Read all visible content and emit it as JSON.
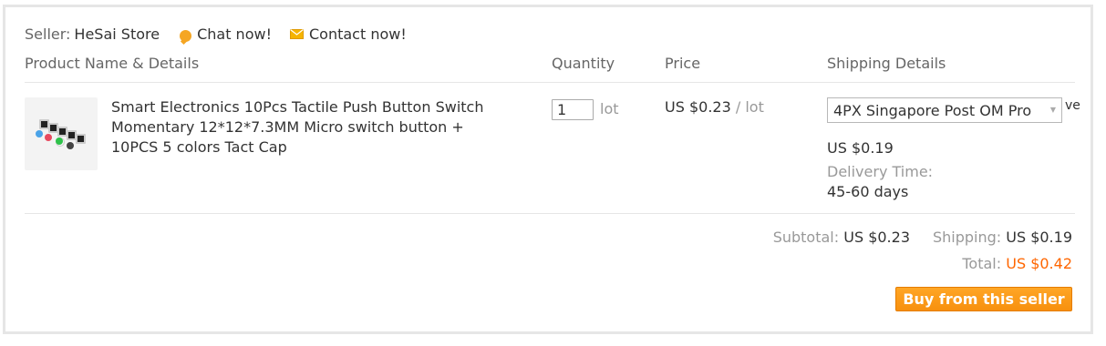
{
  "seller": {
    "label": "Seller:",
    "name": "HeSai Store",
    "chat_label": "Chat now!",
    "contact_label": "Contact now!"
  },
  "columns": {
    "product": "Product Name & Details",
    "quantity": "Quantity",
    "price": "Price",
    "shipping": "Shipping Details"
  },
  "item": {
    "title": "Smart Electronics 10Pcs Tactile Push Button Switch Momentary 12*12*7.3MM Micro switch button + 10PCS 5 colors Tact Cap",
    "quantity": "1",
    "quantity_unit": "lot",
    "price": "US $0.23",
    "price_unit": "/ lot",
    "shipping_method": "4PX Singapore Post OM Pro",
    "shipping_method_clip": "ve",
    "shipping_price": "US $0.19",
    "delivery_label": "Delivery Time:",
    "delivery_value": "45-60 days"
  },
  "summary": {
    "subtotal_label": "Subtotal:",
    "subtotal_value": "US $0.23",
    "shipping_label": "Shipping:",
    "shipping_value": "US $0.19",
    "total_label": "Total:",
    "total_value": "US $0.42"
  },
  "buy_button": "Buy from this seller",
  "colors": {
    "accent": "#ff6600",
    "button": "#f7900e",
    "chat_icon": "#f5a623"
  },
  "icons": {
    "chat": "chat-bubble-icon",
    "contact": "envelope-icon",
    "dropdown": "chevron-down-icon"
  }
}
